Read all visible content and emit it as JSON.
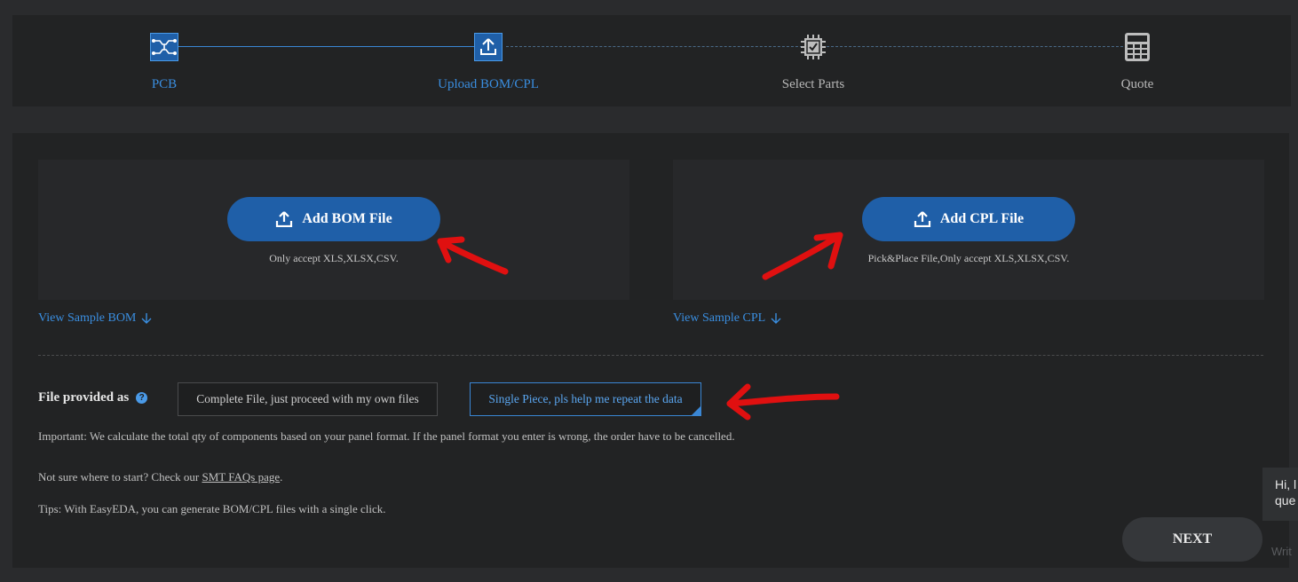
{
  "stepper": {
    "steps": [
      {
        "label": "PCB",
        "icon": "pcb-icon",
        "state": "done"
      },
      {
        "label": "Upload BOM/CPL",
        "icon": "upload-icon",
        "state": "active"
      },
      {
        "label": "Select Parts",
        "icon": "chip-icon",
        "state": "pending"
      },
      {
        "label": "Quote",
        "icon": "calculator-icon",
        "state": "pending"
      }
    ]
  },
  "upload": {
    "bom": {
      "button": "Add BOM File",
      "note": "Only accept XLS,XLSX,CSV.",
      "sample_link": "View Sample BOM"
    },
    "cpl": {
      "button": "Add CPL File",
      "note": "Pick&Place File,Only accept XLS,XLSX,CSV.",
      "sample_link": "View Sample CPL"
    }
  },
  "file_provided": {
    "label": "File provided as",
    "options": [
      "Complete File, just proceed with my own files",
      "Single Piece, pls help me repeat the data"
    ],
    "selected": 1
  },
  "info": {
    "important": "Important: We calculate the total qty of components based on your panel format. If the panel format you enter is wrong, the order have to be cancelled.",
    "faq_prefix": "Not sure where to start? Check our ",
    "faq_link": "SMT FAQs page",
    "faq_suffix": ".",
    "tips": "Tips: With EasyEDA, you can generate BOM/CPL files with a single click."
  },
  "next_button": "NEXT",
  "chat": {
    "line1": "Hi, l",
    "line2": "que",
    "input_placeholder": "Writ"
  },
  "colors": {
    "accent": "#3a8ee0",
    "button_blue": "#1f5fa8",
    "annotation_red": "#e01010"
  }
}
